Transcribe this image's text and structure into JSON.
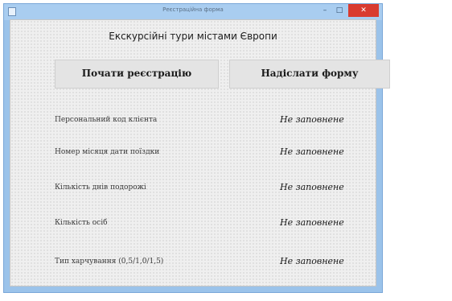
{
  "window": {
    "title": "Реєстраційна форма",
    "minimize_glyph": "–",
    "maximize_glyph": "□",
    "close_glyph": "✕"
  },
  "heading": "Екскурсійні тури містами Європи",
  "buttons": {
    "start": "Почати реєстрацію",
    "send": "Надіслати форму"
  },
  "fields": [
    {
      "label": "Персональний код клієнта",
      "value": "Не заповнене"
    },
    {
      "label": "Номер місяця дати поїздки",
      "value": "Не заповнене"
    },
    {
      "label": "Кількість днів подорожі",
      "value": "Не заповнене"
    },
    {
      "label": "Кількість осіб",
      "value": "Не заповнене"
    },
    {
      "label": "Тип харчування (0,5/1,0/1,5)",
      "value": "Не заповнене"
    }
  ]
}
